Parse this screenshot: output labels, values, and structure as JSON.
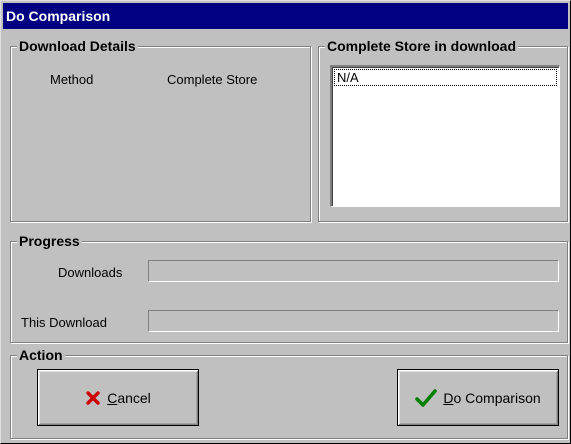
{
  "window": {
    "title": "Do Comparison"
  },
  "download_details": {
    "legend": "Download Details",
    "method_label": "Method",
    "method_value": "Complete Store"
  },
  "complete_store": {
    "legend": "Complete Store in download",
    "items": [
      "N/A"
    ]
  },
  "progress": {
    "legend": "Progress",
    "downloads_label": "Downloads",
    "downloads_percent": 0,
    "this_download_label": "This Download",
    "this_download_percent": 0
  },
  "action": {
    "legend": "Action",
    "cancel": {
      "mnemonic": "C",
      "label_rest": "ancel",
      "icon": "red-x-icon",
      "icon_color": "#cc0000"
    },
    "do_comparison": {
      "mnemonic": "D",
      "label_rest": "o Comparison",
      "icon": "green-checkmark-icon",
      "icon_color": "#008000"
    }
  }
}
